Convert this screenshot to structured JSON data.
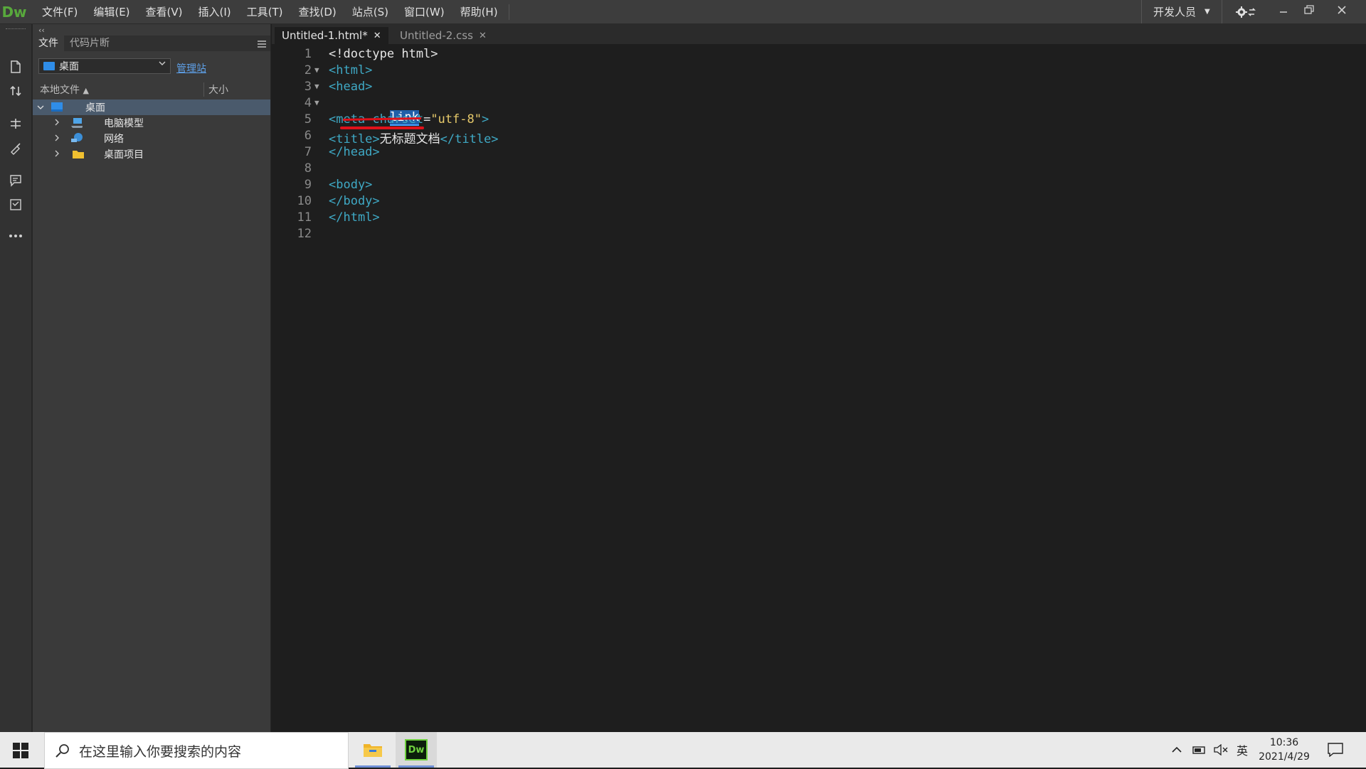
{
  "app": {
    "logo": "Dw",
    "menu": [
      "文件(F)",
      "编辑(E)",
      "查看(V)",
      "插入(I)",
      "工具(T)",
      "查找(D)",
      "站点(S)",
      "窗口(W)",
      "帮助(H)"
    ],
    "workspace": "开发人员"
  },
  "files_panel": {
    "collapse": "‹‹",
    "tabs": [
      "文件",
      "代码片断"
    ],
    "site": "桌面",
    "manage_link": "管理站",
    "columns": {
      "local": "本地文件",
      "size": "大小"
    },
    "tree": [
      {
        "label": "桌面",
        "icon": "desktop-icon",
        "expanded": true,
        "selected": true
      },
      {
        "label": "电脑模型",
        "icon": "computer-icon"
      },
      {
        "label": "网络",
        "icon": "network-icon"
      },
      {
        "label": "桌面项目",
        "icon": "folder-icon"
      }
    ]
  },
  "editor": {
    "tabs": [
      {
        "label": "Untitled-1.html*",
        "active": true
      },
      {
        "label": "Untitled-2.css",
        "active": false
      }
    ],
    "lines": [
      "1",
      "2",
      "3",
      "4",
      "5",
      "6",
      "7",
      "8",
      "9",
      "10",
      "11",
      "12"
    ],
    "code": {
      "l1": "<!doctype html>",
      "l2": "<html>",
      "l3": "<head>",
      "l4_word": "link",
      "l5_tag_open": "<meta charset",
      "l5_eq": "=",
      "l5_value": "\"utf-8\"",
      "l5_close": ">",
      "l6_open": "<title>",
      "l6_text": "无标题文档",
      "l6_close": "</title>",
      "l7": "</head>",
      "l9": "<body>",
      "l10": "</body>",
      "l11": "</html>"
    }
  },
  "taskbar": {
    "search_placeholder": "在这里输入你要搜索的内容",
    "ime": "英",
    "time": "10:36",
    "date": "2021/4/29",
    "dw_label": "Dw"
  },
  "colors": {
    "accent_logo": "#58a83c",
    "tag": "#3fa9c5",
    "string": "#e6c96a",
    "selection": "#1f5fa8",
    "underline_annotation": "#e0121a"
  }
}
